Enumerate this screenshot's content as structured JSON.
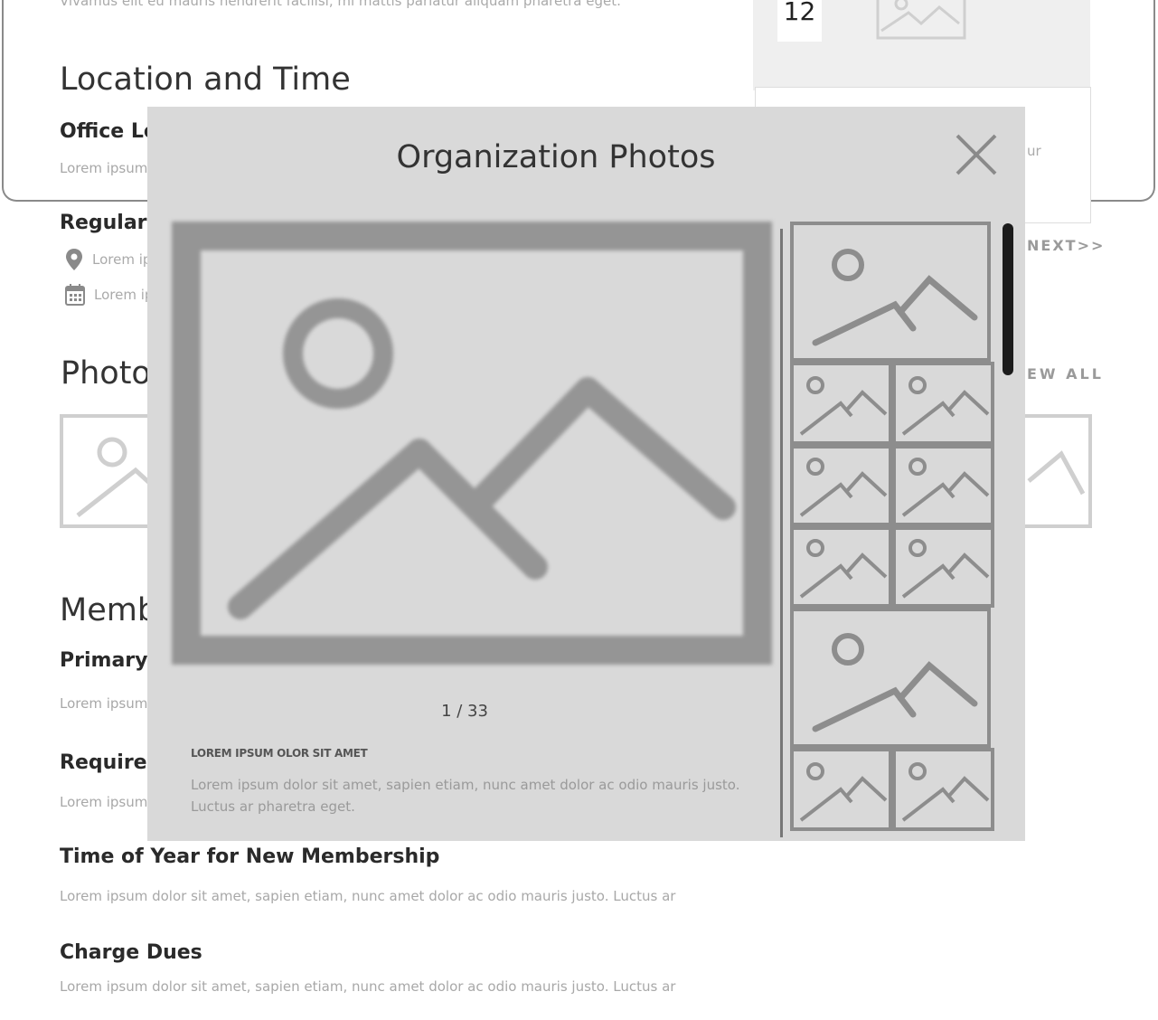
{
  "background": {
    "cut_text": "Vivamus elit eu mauris hendrerit facilisi, mi mattis pariatur aliquam pharetra eget.",
    "location_title": "Location and Time",
    "office_location_label": "Office Lo",
    "office_location_text": "Lorem ipsum",
    "regular_label": "Regular",
    "location_meta": "Lorem ip",
    "date_meta": "Lorem ip",
    "photos_title": "Photo",
    "view_all": "EW ALL",
    "members_title": "Memb",
    "primary_label": "Primary",
    "primary_text": "Lorem ipsum",
    "requirements_label": "Requirer",
    "requirements_text": "Lorem ipsum",
    "time_of_year_label": "Time of Year for New Membership",
    "time_of_year_text": "Lorem ipsum dolor sit amet, sapien etiam, nunc amet dolor ac odio mauris justo. Luctus ar",
    "charge_dues_label": "Charge Dues",
    "charge_dues_text": "Lorem ipsum dolor sit amet, sapien etiam, nunc amet dolor ac odio mauris justo. Luctus ar",
    "side_badge": "12",
    "side_box_text": "ur",
    "next_link": "NEXT>>"
  },
  "modal": {
    "title": "Organization Photos",
    "counter": "1 / 33",
    "caption_title": "LOREM IPSUM OLOR SIT AMET",
    "caption_text": "Lorem ipsum dolor sit amet, sapien etiam, nunc amet dolor ac odio mauris justo. Luctus ar pharetra eget.",
    "close_icon": "close-icon",
    "placeholder_icon": "image-placeholder-icon"
  },
  "colors": {
    "modal_bg": "#d9d9d9",
    "placeholder_stroke": "#8d8d8d",
    "scrollbar": "#1c1c1c"
  }
}
